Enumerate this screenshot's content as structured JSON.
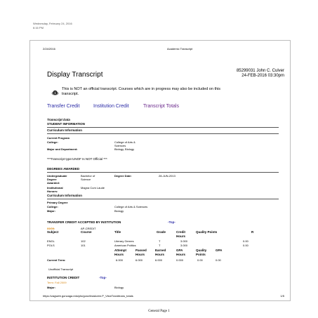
{
  "print_header": {
    "date": "Wednesday, February 24, 2016",
    "time": "6:16 PM"
  },
  "browser_header": {
    "date": "2/24/2016",
    "title": "Academic Transcript"
  },
  "student": {
    "id_name": "85299031 John C. Culver",
    "datetime": "24-FEB-2016 03:30pm"
  },
  "page_title": "Display Transcript",
  "notice": {
    "line1": "This is NOT an official transcript. Courses which are in progress may also be included on this",
    "line2": "transcript."
  },
  "nav_links": [
    "Transfer Credit",
    "Institution Credit",
    "Transcript Totals"
  ],
  "transcript_data": {
    "heading": "Transcript Data",
    "student_info": "STUDENT INFORMATION",
    "curriculum_info": "Curriculum Information",
    "current_program": "Current Program",
    "college_label": "College:",
    "college_value_1": "College of Arts &",
    "college_value_2": "Sciences",
    "major_dept_label": "Major and Department:",
    "major_dept_value": "Biology, Biology",
    "transcript_type": "***Transcript type:UNOF Is NOT Official ***"
  },
  "degrees": {
    "heading": "DEGREES AWARDED",
    "undergrad_label_1": "Undergraduate",
    "undergrad_label_2": "Degree",
    "undergrad_label_3": "Awarded:",
    "undergrad_value_1": "Bachelor of",
    "undergrad_value_2": "Science",
    "degree_date_label": "Degree Date:",
    "degree_date_value": "28-JUN-2013",
    "honors_label_1": "Institutional",
    "honors_label_2": "Honors:",
    "honors_value": "Magna Cum Laude",
    "curriculum_info": "Curriculum Information",
    "primary_degree": "Primary Degree",
    "college_label": "College:",
    "college_value": "College of Arts & Sciences",
    "major_label": "Major:",
    "major_value": "Biology"
  },
  "transfer": {
    "heading": "TRANSFER CREDIT ACCEPTED BY INSTITUTION",
    "top_link": "-Top-",
    "term": "09/09:",
    "source": "AP-CREDIT",
    "columns": [
      "Subject",
      "Course",
      "Title",
      "Grade",
      "Credit Hours",
      "Quality Points",
      "R"
    ],
    "rows": [
      {
        "subject": "ENGL",
        "course": "102",
        "title": "Literary Genres",
        "grade": "T",
        "credit": "3.000",
        "quality": "0.00"
      },
      {
        "subject": "POLS",
        "course": "101",
        "title": "American Politics",
        "grade": "T",
        "credit": "3.000",
        "quality": "0.00"
      }
    ],
    "totals_columns": [
      "Attempt Hours",
      "Passed Hours",
      "Earned Hours",
      "GPA Hours",
      "Quality Points",
      "GPA"
    ],
    "current_term_label": "Current Term:",
    "current_term_values": [
      "6.000",
      "6.000",
      "6.000",
      "0.000",
      "0.00",
      "0.00"
    ]
  },
  "unofficial": "Unofficial Transcript",
  "institution": {
    "heading": "INSTITUTION CREDIT",
    "top_link": "-Top-",
    "term": "Term: Fall 2009",
    "major_label": "Major:",
    "major_value": "Biology"
  },
  "footer": {
    "url": "https://zagweb.gonzaga.edu/pls/gonz/bwskotrn.P_ViewTran#trans_totals",
    "page": "1/5",
    "general_page": "General Page 1"
  },
  "colors": {
    "link": "#2a2aa6",
    "term": "#d98a1a"
  },
  "icons": [
    "info-icon"
  ]
}
